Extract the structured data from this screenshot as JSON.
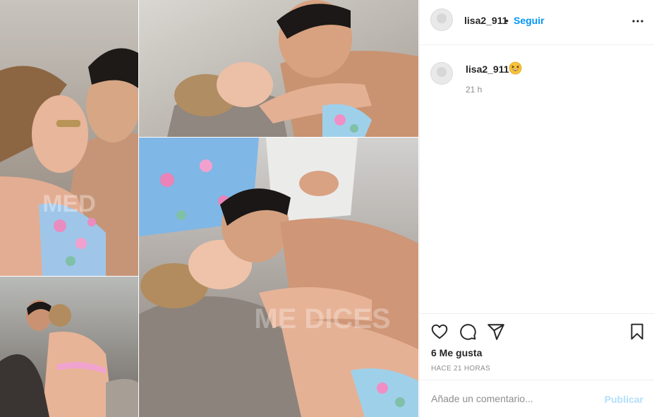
{
  "post": {
    "images": [
      {
        "name": "photo-top-left"
      },
      {
        "name": "photo-top-right"
      },
      {
        "name": "photo-middle-right"
      },
      {
        "name": "photo-bottom-left"
      }
    ],
    "watermark_text": "¡QUÉ ME DICES!"
  },
  "header": {
    "username": "lisa2_911",
    "separator": "•",
    "follow_label": "Seguir",
    "more_icon": "more-horizontal-icon"
  },
  "caption": {
    "username": "lisa2_911",
    "emoji": "grinning-squinting-face",
    "time": "21 h"
  },
  "actions": {
    "like_icon": "heart-icon",
    "comment_icon": "comment-icon",
    "share_icon": "paper-plane-icon",
    "save_icon": "bookmark-icon",
    "likes_text": "6 Me gusta",
    "timestamp": "HACE 21 HORAS"
  },
  "add_comment": {
    "placeholder": "Añade un comentario...",
    "publish_label": "Publicar"
  },
  "colors": {
    "link_blue": "#0095f6",
    "publish_disabled": "#b2dffc",
    "muted_text": "#8e8e8e",
    "border": "#efefef",
    "text": "#262626"
  }
}
